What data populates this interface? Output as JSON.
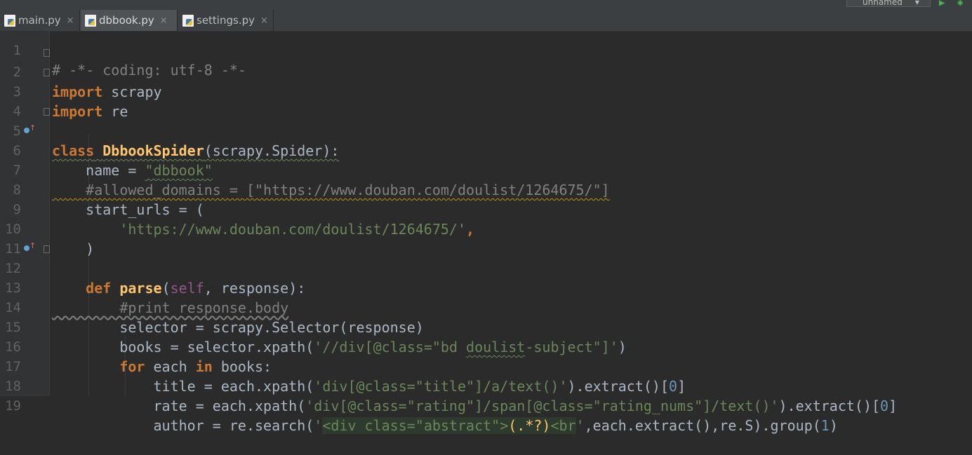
{
  "tabs": [
    {
      "label": "main.py",
      "active": false
    },
    {
      "label": "dbbook.py",
      "active": true
    },
    {
      "label": "settings.py",
      "active": false
    }
  ],
  "tab_close": "×",
  "run_config": {
    "label": "unnamed",
    "arrow": "▾"
  },
  "toolbar_icons": {
    "run": "▶",
    "debug": "✱"
  },
  "file_icon": "python-file-icon",
  "line_numbers": [
    "1",
    "2",
    "3",
    "4",
    "5",
    "6",
    "7",
    "8",
    "9",
    "10",
    "11",
    "12",
    "13",
    "14",
    "15",
    "16",
    "17",
    "18",
    "19"
  ],
  "code": {
    "l1": "# -*- coding: utf-8 -*-",
    "l2_kw": "import",
    "l2_rest": " scrapy",
    "l3_kw": "import",
    "l3_rest": " re",
    "l5_kw": "class",
    "l5_name": "DbbookSpider",
    "l5_rest": "(scrapy.Spider):",
    "l6_a": "    name = ",
    "l6_s": "\"dbbook\"",
    "l7": "    #allowed_domains = [\"https://www.douban.com/doulist/1264675/\"]",
    "l8": "    start_urls = (",
    "l9_a": "        ",
    "l9_s": "'https://www.douban.com/doulist/1264675/'",
    "l9_b": ",",
    "l10": "    )",
    "l12_a": "    ",
    "l12_kw": "def",
    "l12_fn": "parse",
    "l12_b": "(",
    "l12_self": "self",
    "l12_c": ", response):",
    "l13": "        #print response.body",
    "l14": "        selector = scrapy.Selector(response)",
    "l15_a": "        books = selector.xpath(",
    "l15_s1": "'//div[@class=\"bd ",
    "l15_s2": "doulist",
    "l15_s3": "-subject\"]'",
    "l15_b": ")",
    "l16_a": "        ",
    "l16_kw": "for",
    "l16_b": " each ",
    "l16_kw2": "in",
    "l16_c": " books:",
    "l17_a": "            title = each.xpath(",
    "l17_s": "'div[@class=\"title\"]/a/text()'",
    "l17_b": ").extract()[",
    "l17_n": "0",
    "l17_c": "]",
    "l18_a": "            rate = each.xpath(",
    "l18_s": "'div[@class=\"rating\"]/span[@class=\"rating_nums\"]/text()'",
    "l18_b": ").extract()[",
    "l18_n": "0",
    "l18_c": "]",
    "l19_a": "            author = re.search(",
    "l19_s1": "'",
    "l19_s2": "<div class=\"abstract\">",
    "l19_s3": "(.*?)",
    "l19_s4": "<br",
    "l19_s5": "'",
    "l19_b": ",each.extract(),re.S).group(",
    "l19_n": "1",
    "l19_c": ")"
  },
  "colors": {
    "background": "#2b2b2b",
    "keyword": "#cc7832",
    "string": "#6a8759",
    "comment": "#808080",
    "function": "#ffc66d",
    "self": "#94558d",
    "number": "#6897bb",
    "text": "#a9b7c6"
  }
}
